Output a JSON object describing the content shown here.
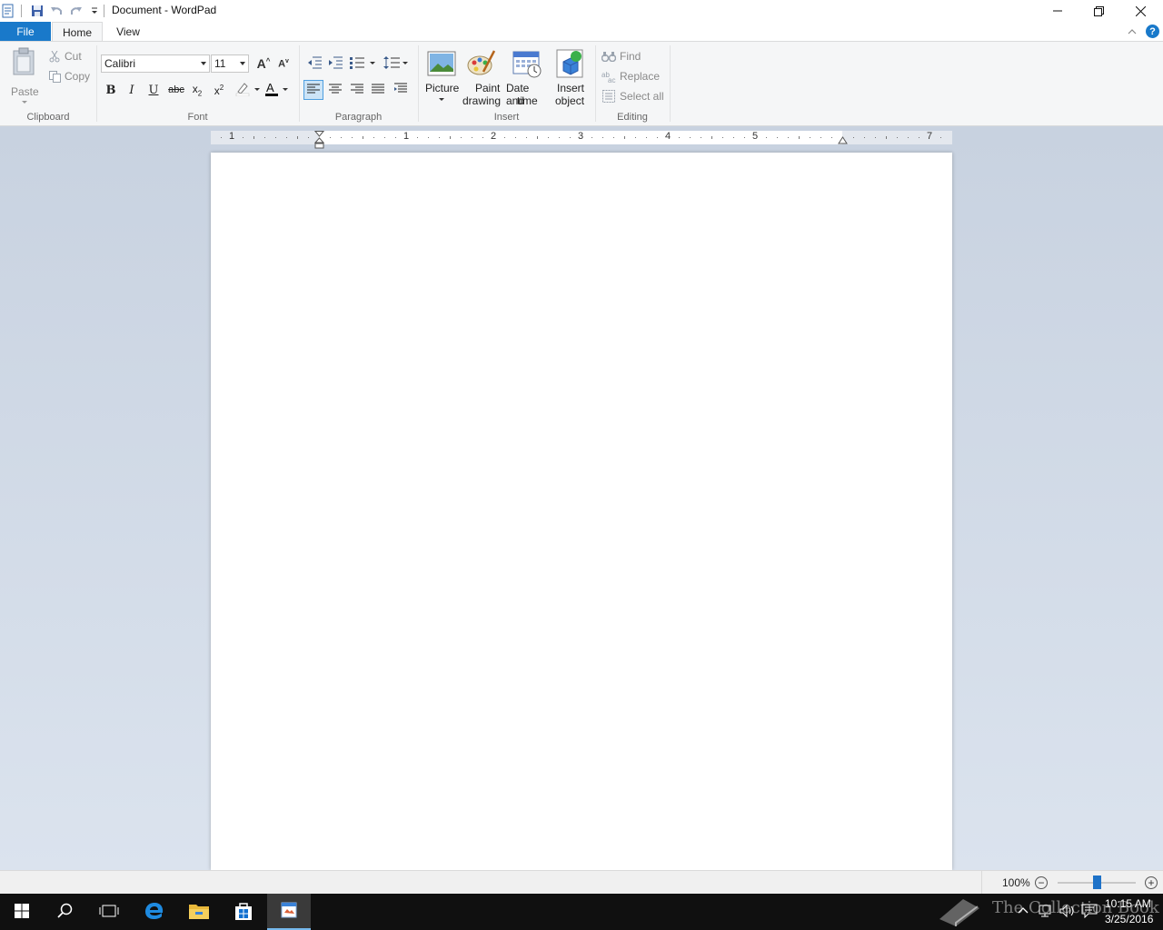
{
  "window": {
    "title": "Document - WordPad"
  },
  "tabs": {
    "file": "File",
    "home": "Home",
    "view": "View"
  },
  "clipboard": {
    "paste": "Paste",
    "cut": "Cut",
    "copy": "Copy",
    "label": "Clipboard"
  },
  "font": {
    "family": "Calibri",
    "size": "11",
    "label": "Font"
  },
  "paragraph": {
    "label": "Paragraph"
  },
  "insert": {
    "picture": "Picture",
    "paint_line1": "Paint",
    "paint_line2": "drawing",
    "datetime_line1": "Date and",
    "datetime_line2": "time",
    "object_line1": "Insert",
    "object_line2": "object",
    "label": "Insert"
  },
  "editing": {
    "find": "Find",
    "replace": "Replace",
    "select_all": "Select all",
    "label": "Editing"
  },
  "ruler": {
    "numbers": [
      "1",
      "1",
      "2",
      "3",
      "4",
      "5",
      "7"
    ]
  },
  "status": {
    "zoom": "100%",
    "zoom_fraction": 0.5
  },
  "taskbar": {
    "time": "10:15 AM",
    "date": "3/25/2016",
    "watermark": "The Collection Book"
  },
  "colors": {
    "accent": "#1979ca",
    "ribbon_bg": "#f5f6f7",
    "workspace_bg": "#d2dbe8",
    "taskbar_bg": "#101010"
  }
}
